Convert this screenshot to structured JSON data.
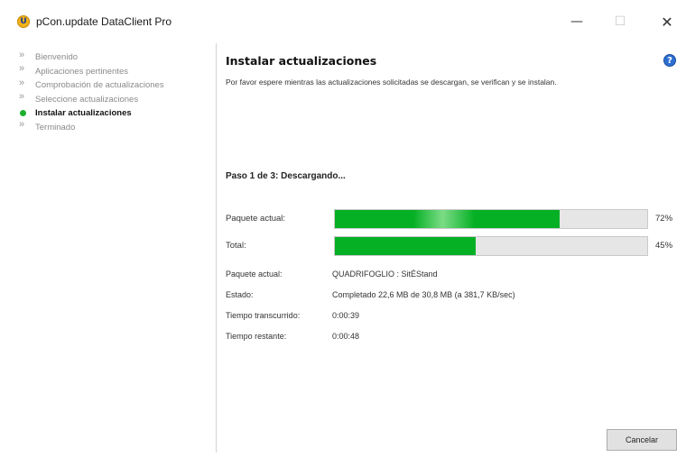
{
  "window": {
    "title": "pCon.update DataClient Pro",
    "app_icon_glyph": "U",
    "controls": {
      "minimize": "—",
      "maximize": "☐",
      "close": "✕"
    }
  },
  "sidebar": {
    "steps": [
      {
        "label": "Bienvenido",
        "state": "done"
      },
      {
        "label": "Aplicaciones pertinentes",
        "state": "done"
      },
      {
        "label": "Comprobación de actualizaciones",
        "state": "done"
      },
      {
        "label": "Seleccione actualizaciones",
        "state": "done"
      },
      {
        "label": "Instalar actualizaciones",
        "state": "current"
      },
      {
        "label": "Terminado",
        "state": "pending"
      }
    ]
  },
  "main": {
    "heading": "Instalar actualizaciones",
    "help_glyph": "?",
    "subtitle": "Por favor espere mientras las actualizaciones solicitadas se descargan, se verifican y se instalan.",
    "phase": "Paso 1 de 3: Descargando...",
    "progress": [
      {
        "label": "Paquete actual:",
        "percent": 72,
        "percent_text": "72%"
      },
      {
        "label": "Total:",
        "percent": 45,
        "percent_text": "45%"
      }
    ],
    "info": [
      {
        "key": "Paquete actual:",
        "value": "QUADRIFOGLIO : SitÉStand"
      },
      {
        "key": "Estado:",
        "value": "Completado 22,6 MB de 30,8 MB (a 381,7 KB/sec)"
      },
      {
        "key": "Tiempo transcurrido:",
        "value": "0:00:39"
      },
      {
        "key": "Tiempo restante:",
        "value": "0:00:48"
      }
    ],
    "cancel_label": "Cancelar"
  },
  "colors": {
    "progress_fill": "#06b025",
    "current_step_dot": "#1bb02e",
    "help_icon": "#2d6fd0"
  }
}
